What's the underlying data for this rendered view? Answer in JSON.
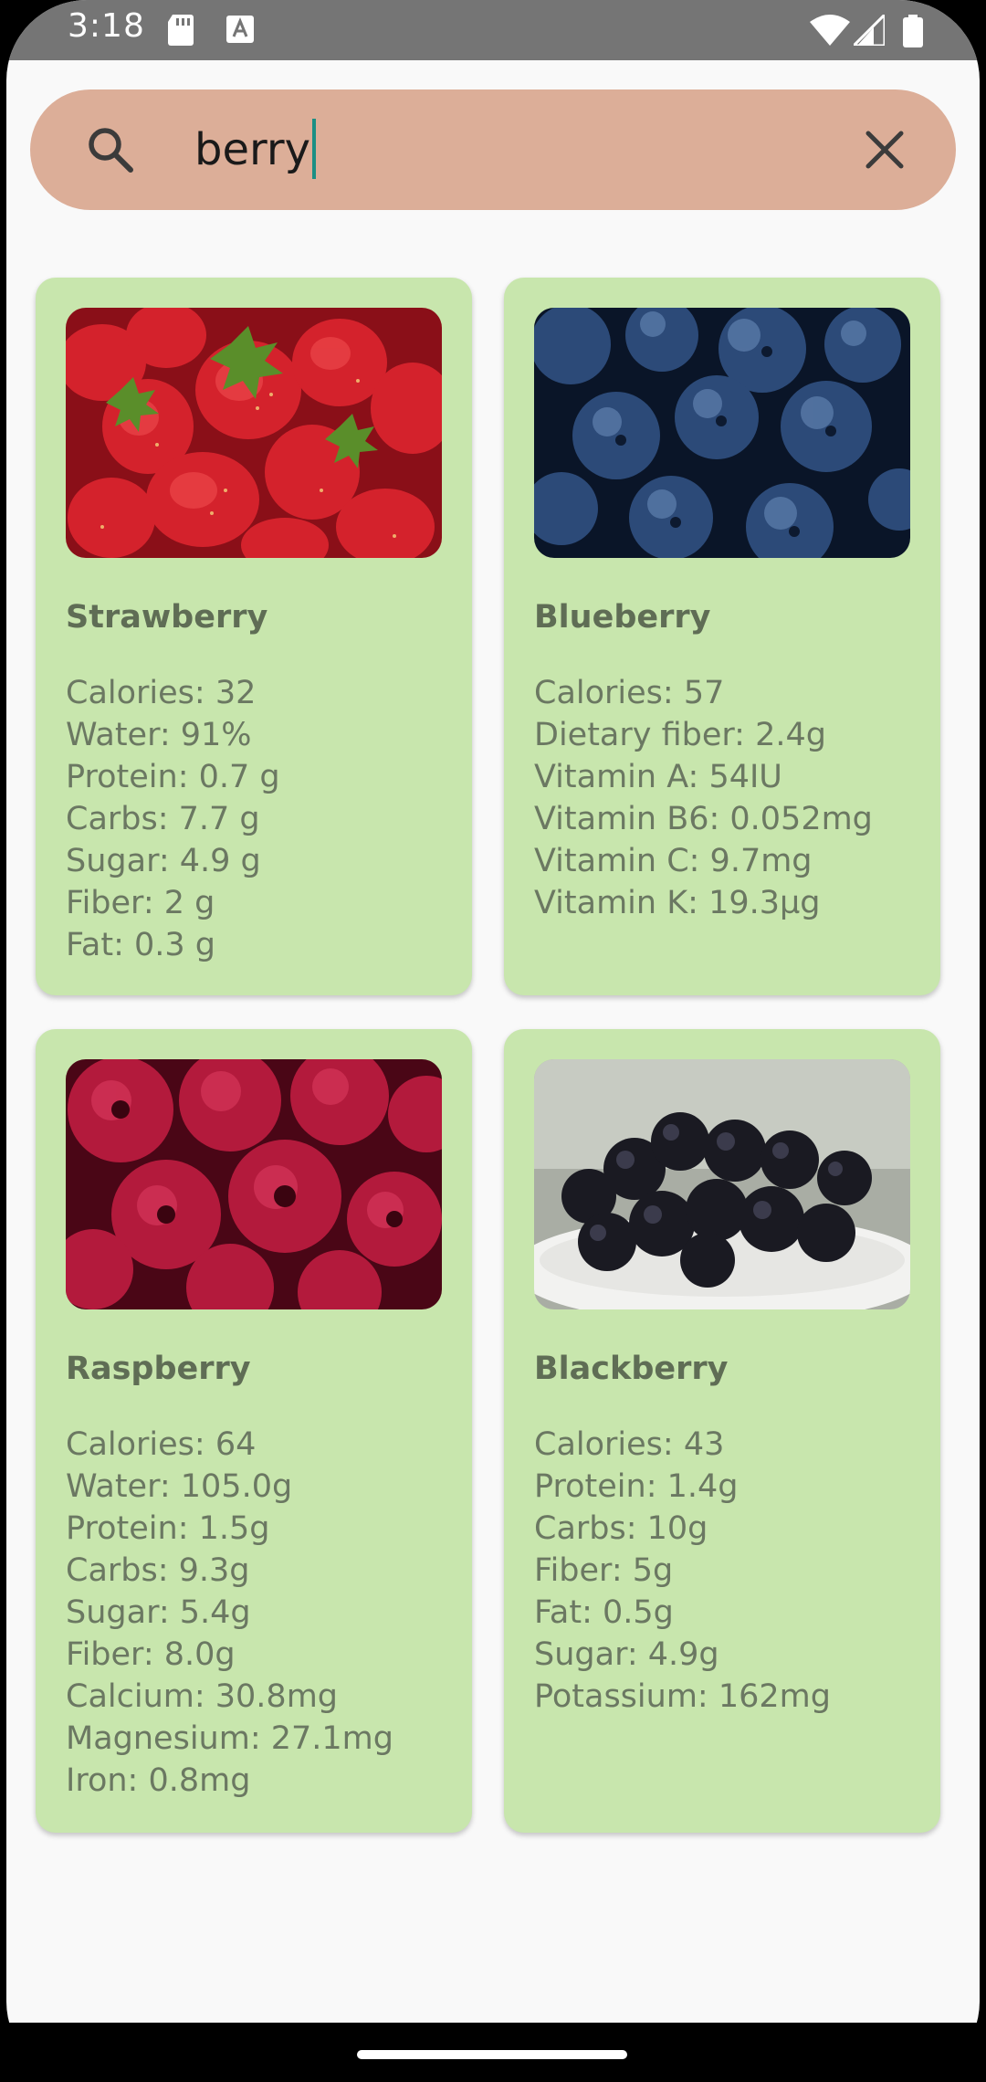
{
  "status_bar": {
    "time": "3:18",
    "icons_left": [
      "sd-card-icon",
      "text-a-icon"
    ],
    "icons_right": [
      "wifi-icon",
      "signal-icon",
      "battery-icon"
    ]
  },
  "search": {
    "query": "berry",
    "search_icon": "search-icon",
    "clear_icon": "close-icon"
  },
  "fruits": [
    {
      "name": "Strawberry",
      "image": "strawberries-photo",
      "lines": [
        "Calories: 32",
        "Water: 91%",
        "Protein: 0.7 g",
        "Carbs: 7.7 g",
        "Sugar: 4.9 g",
        "Fiber: 2 g",
        "Fat: 0.3 g"
      ]
    },
    {
      "name": "Blueberry",
      "image": "blueberries-photo",
      "lines": [
        "Calories: 57",
        "Dietary fiber: 2.4g",
        "Vitamin A: 54IU",
        "Vitamin B6: 0.052mg",
        "Vitamin C: 9.7mg",
        "Vitamin K: 19.3µg"
      ]
    },
    {
      "name": "Raspberry",
      "image": "raspberries-photo",
      "lines": [
        "Calories: 64",
        "Water: 105.0g",
        "Protein: 1.5g",
        "Carbs: 9.3g",
        "Sugar: 5.4g",
        "Fiber: 8.0g",
        "Calcium: 30.8mg",
        "Magnesium: 27.1mg",
        "Iron: 0.8mg"
      ]
    },
    {
      "name": "Blackberry",
      "image": "blackberries-photo",
      "lines": [
        "Calories: 43",
        "Protein: 1.4g",
        "Carbs: 10g",
        "Fiber: 5g",
        "Fat: 0.5g",
        "Sugar: 4.9g",
        "Potassium: 162mg"
      ]
    }
  ],
  "colors": {
    "search_bar": "#dcae98",
    "card_background": "#c8e6ad",
    "title_text": "#5f6d55",
    "body_text": "#6b7862",
    "cursor": "#1b8f84",
    "status_bar": "#757575"
  }
}
